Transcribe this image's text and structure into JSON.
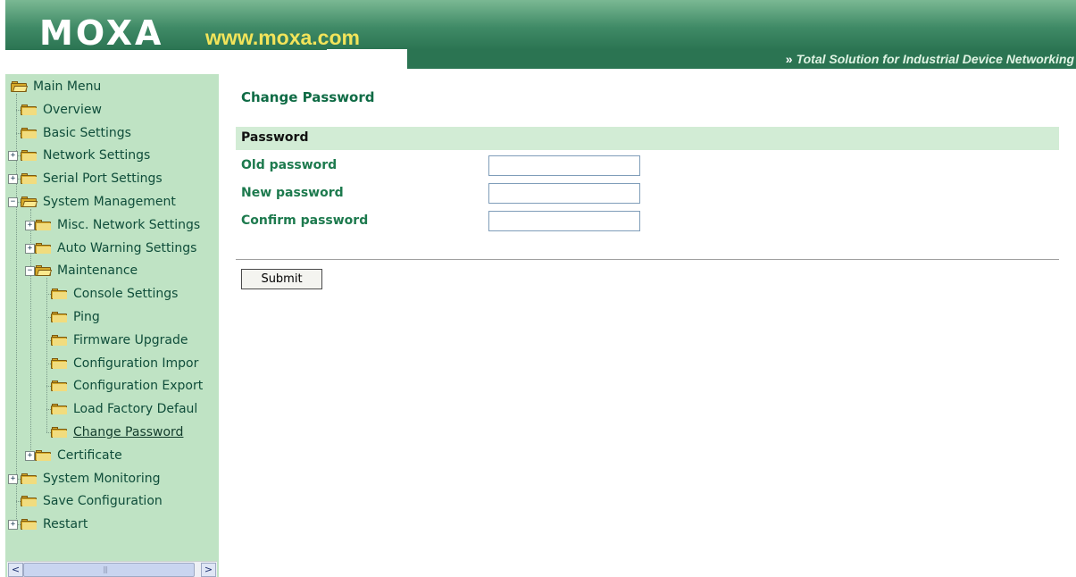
{
  "header": {
    "logo": "MOXA",
    "site": "www.moxa.com",
    "tagline": "Total Solution for Industrial Device Networking",
    "tagline_icon": "double-chevron-right-icon"
  },
  "sidebar": {
    "items": [
      {
        "label": "Main Menu",
        "icon": "open-folder-icon",
        "expander": ""
      },
      {
        "label": "Overview",
        "icon": "folder-icon",
        "expander": ""
      },
      {
        "label": "Basic Settings",
        "icon": "folder-icon",
        "expander": ""
      },
      {
        "label": "Network Settings",
        "icon": "folder-icon",
        "expander": "+"
      },
      {
        "label": "Serial Port Settings",
        "icon": "folder-icon",
        "expander": "+"
      },
      {
        "label": "System Management",
        "icon": "open-folder-icon",
        "expander": "−"
      },
      {
        "label": "Misc. Network Settings",
        "icon": "folder-icon",
        "expander": "+"
      },
      {
        "label": "Auto Warning Settings",
        "icon": "folder-icon",
        "expander": "+"
      },
      {
        "label": "Maintenance",
        "icon": "open-folder-icon",
        "expander": "−"
      },
      {
        "label": "Console Settings",
        "icon": "folder-icon",
        "expander": ""
      },
      {
        "label": "Ping",
        "icon": "folder-icon",
        "expander": ""
      },
      {
        "label": "Firmware Upgrade",
        "icon": "folder-icon",
        "expander": ""
      },
      {
        "label": "Configuration Impor",
        "icon": "folder-icon",
        "expander": ""
      },
      {
        "label": "Configuration Export",
        "icon": "folder-icon",
        "expander": ""
      },
      {
        "label": "Load Factory Defaul",
        "icon": "folder-icon",
        "expander": ""
      },
      {
        "label": "Change Password",
        "icon": "folder-icon",
        "expander": "",
        "current": true
      },
      {
        "label": "Certificate",
        "icon": "folder-icon",
        "expander": "+"
      },
      {
        "label": "System Monitoring",
        "icon": "folder-icon",
        "expander": "+"
      },
      {
        "label": "Save Configuration",
        "icon": "folder-icon",
        "expander": ""
      },
      {
        "label": "Restart",
        "icon": "folder-icon",
        "expander": "+"
      }
    ],
    "scroll_left": "<",
    "scroll_right": ">"
  },
  "main": {
    "title": "Change Password",
    "section": "Password",
    "fields": [
      {
        "label": "Old password",
        "value": ""
      },
      {
        "label": "New password",
        "value": ""
      },
      {
        "label": "Confirm password",
        "value": ""
      }
    ],
    "submit_label": "Submit"
  },
  "colors": {
    "header_green": "#2b7452",
    "sidebar_bg": "#bfe3c4",
    "section_bar": "#d2ecd5",
    "label_green": "#1d7a4e",
    "site_yellow": "#f2e45a"
  }
}
